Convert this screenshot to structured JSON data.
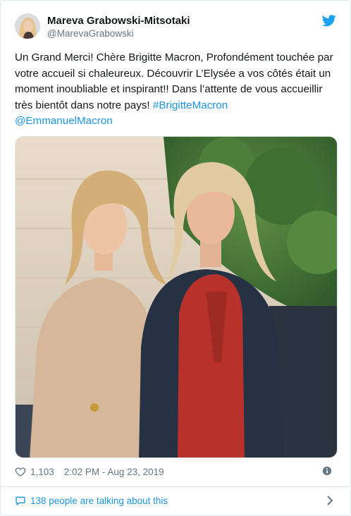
{
  "tweet": {
    "author_name": "Mareva Grabowski-Mitsotaki",
    "author_handle": "@MarevaGrabowski",
    "text_part1": "Un Grand Merci! Chère Brigitte Macron, Profondément touchée par votre accueil si chaleureux. Découvrir L’Elysée a vos côtés était un moment inoubliable et inspirant!! Dans l’attente de vous accueillir très bientôt dans notre pays! ",
    "hashtag": "#BrigitteMacron",
    "mention": "@EmmanuelMacron",
    "likes": "1,103",
    "timestamp": "2:02 PM - Aug 23, 2019",
    "talking": "138 people are talking about this"
  },
  "icons": {
    "brand": "twitter-bird-icon",
    "like": "heart-icon",
    "info": "info-icon",
    "reply": "speech-bubble-icon",
    "more": "chevron-right-icon"
  },
  "colors": {
    "link": "#1b95e0",
    "muted": "#657786",
    "border": "#e1e8ed"
  }
}
